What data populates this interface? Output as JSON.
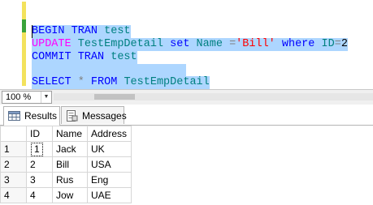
{
  "editor": {
    "lines": [
      [
        {
          "t": "BEGIN TRAN ",
          "c": "kw"
        },
        {
          "t": "test",
          "c": "id"
        }
      ],
      [
        {
          "t": "UPDATE ",
          "c": "kwp"
        },
        {
          "t": "TestEmpDetail ",
          "c": "id"
        },
        {
          "t": "set ",
          "c": "kw"
        },
        {
          "t": "Name ",
          "c": "id"
        },
        {
          "t": "=",
          "c": "op"
        },
        {
          "t": "'Bill'",
          "c": "str"
        },
        {
          "t": " where ",
          "c": "kw"
        },
        {
          "t": "ID",
          "c": "id"
        },
        {
          "t": "=",
          "c": "op"
        },
        {
          "t": "2",
          "c": ""
        }
      ],
      [
        {
          "t": "COMMIT TRAN ",
          "c": "kw"
        },
        {
          "t": "test",
          "c": "id"
        }
      ],
      [
        {
          "t": "",
          "c": ""
        }
      ],
      [
        {
          "t": "SELECT ",
          "c": "kw"
        },
        {
          "t": "* ",
          "c": "op"
        },
        {
          "t": "FROM ",
          "c": "kw"
        },
        {
          "t": "TestEmpDetail",
          "c": "id"
        }
      ]
    ]
  },
  "zoom": {
    "value": "100 %"
  },
  "tabs": {
    "results": "Results",
    "messages": "Messages"
  },
  "grid": {
    "columns": [
      "",
      "ID",
      "Name",
      "Address"
    ],
    "rows": [
      [
        "1",
        "1",
        "Jack",
        "UK"
      ],
      [
        "2",
        "2",
        "Bill",
        "USA"
      ],
      [
        "3",
        "3",
        "Rus",
        "Eng"
      ],
      [
        "4",
        "4",
        "Jow",
        "UAE"
      ]
    ]
  }
}
